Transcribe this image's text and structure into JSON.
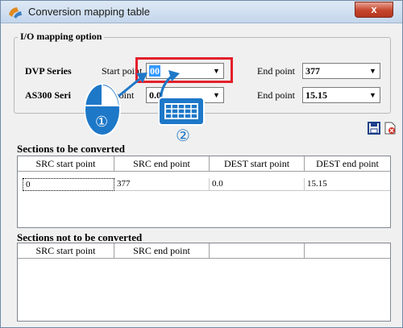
{
  "window": {
    "title": "Conversion mapping table",
    "close_glyph": "x"
  },
  "io_group": {
    "title": "I/O mapping option",
    "dvp": {
      "label": "DVP Series",
      "start_label": "Start point",
      "start_value": "00",
      "end_label": "End point",
      "end_value": "377"
    },
    "as300": {
      "label": "AS300 Seri",
      "start_label": "art point",
      "start_value": "0.0",
      "end_label": "End point",
      "end_value": "15.15"
    }
  },
  "toolbar": {
    "save_icon": "save-icon",
    "delete_icon": "delete-icon"
  },
  "converted": {
    "title": "Sections to be converted",
    "columns": [
      "SRC start point",
      "SRC end point",
      "DEST start point",
      "DEST end point"
    ],
    "rows": [
      [
        "0",
        "377",
        "0.0",
        "15.15"
      ]
    ]
  },
  "not_converted": {
    "title": "Sections not to be converted",
    "columns": [
      "SRC start point",
      "SRC end point",
      "",
      ""
    ]
  },
  "annotations": {
    "step1": "①",
    "step2": "②",
    "accent": "#1e78c8",
    "highlight": "#e3202a"
  }
}
